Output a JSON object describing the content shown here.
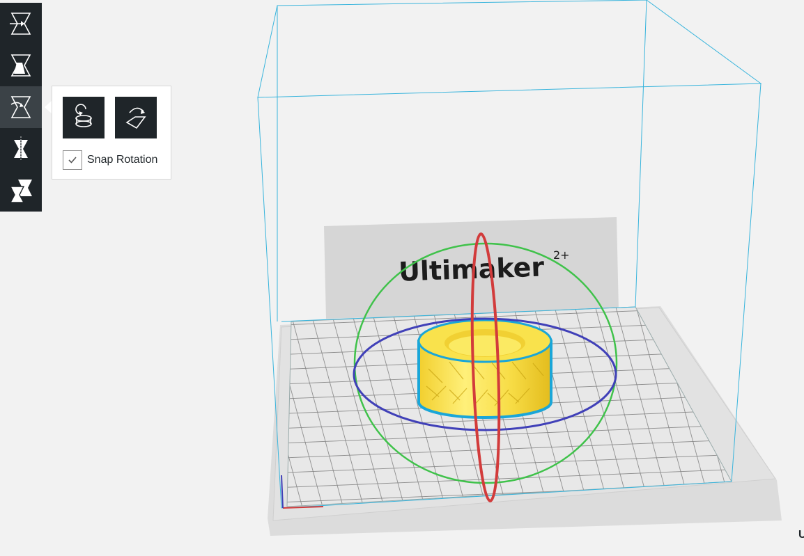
{
  "toolbar": {
    "items": [
      {
        "id": "move",
        "icon": "move-tool-icon"
      },
      {
        "id": "scale",
        "icon": "scale-tool-icon"
      },
      {
        "id": "rotate",
        "icon": "rotate-tool-icon",
        "active": true
      },
      {
        "id": "mirror",
        "icon": "mirror-tool-icon"
      },
      {
        "id": "per-model-settings",
        "icon": "per-model-settings-icon"
      }
    ]
  },
  "rotate_panel": {
    "reset_button_icon": "reset-rotation-icon",
    "lay_flat_button_icon": "lay-flat-icon",
    "snap_rotation_label": "Snap Rotation",
    "snap_rotation_checked": true
  },
  "viewport": {
    "printer_logo": "Ultimaker",
    "printer_logo_superscript": "2+",
    "corner_text": "U"
  },
  "colors": {
    "toolbar_bg": "#1f2529",
    "toolbar_active": "#3b4247",
    "build_volume": "#38b4dc",
    "model": "#f9e24c",
    "model_outline": "#1aa6d8",
    "rotate_ring_x": "#d23b3b",
    "rotate_ring_y": "#4040b8",
    "rotate_ring_z": "#3fc24a"
  }
}
